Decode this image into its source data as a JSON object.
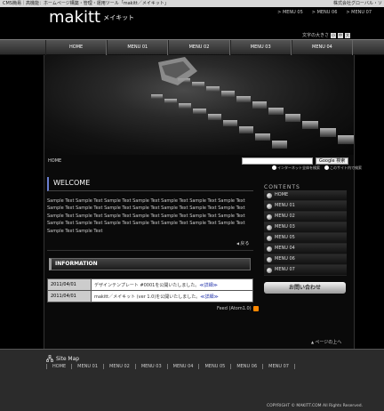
{
  "topbar": {
    "tagline": "CMS簡易｜高機能：ホームページ構築・管理・運用ツール「makitt／メイキット」",
    "company": "株式会社グローバル・ソ"
  },
  "brand": {
    "logo": "makitt",
    "kana": "メイキット"
  },
  "top_menus": [
    "MENU 05",
    "MENU 06",
    "MENU 07"
  ],
  "font_size": {
    "label": "文字の大きさ",
    "buttons": [
      "小",
      "中",
      "大"
    ]
  },
  "gnav": [
    "HOME",
    "MENU 01",
    "MENU 02",
    "MENU 03",
    "MENU 04"
  ],
  "breadcrumb": "HOME",
  "search": {
    "button": "Google 検索",
    "options": [
      "インターネット全体を検索",
      "このサイト内で検索"
    ]
  },
  "main": {
    "title": "WELCOME",
    "lines": [
      "Sample Text Sample Text Sample Text Sample Text Sample Text Sample Text Sample Text",
      "Sample Text Sample Text Sample Text Sample Text Sample Text Sample Text Sample Text",
      "Sample Text Sample Text Sample Text Sample Text Sample Text Sample Text Sample Text",
      "Sample Text Sample Text Sample Text Sample Text Sample Text Sample Text Sample Text",
      "Sample Text Sample Text"
    ],
    "back": "戻る"
  },
  "info": {
    "title": "INFORMATION",
    "rows": [
      {
        "date": "2011/04/01",
        "text": "デザインテンプレート #0001を公開いたしました。",
        "link": "≪詳細≫"
      },
      {
        "date": "2011/04/01",
        "text": "makitt／メイキット (ver 1.0)を公開いたしました。",
        "link": "≪詳細≫"
      }
    ],
    "feed": "Feed (Atom1.0)"
  },
  "sidebar": {
    "heading": "CONTENTS",
    "items": [
      "HOME",
      "MENU 01",
      "MENU 02",
      "MENU 03",
      "MENU 05",
      "MENU 04",
      "MENU 06",
      "MENU 07"
    ],
    "inquiry": "お問い合わせ"
  },
  "page_top": "ページの上へ",
  "footer": {
    "sitemap": "Site Map",
    "nav": [
      "HOME",
      "MENU 01",
      "MENU 02",
      "MENU 03",
      "MENU 04",
      "MENU 05",
      "MENU 06",
      "MENU 07"
    ],
    "copyright": "COPYRIGHT © MAKITT.COM All Rights Reserved."
  },
  "colors": {
    "accent": "#6a7fd0",
    "background": "#000000",
    "link": "#2233aa"
  }
}
